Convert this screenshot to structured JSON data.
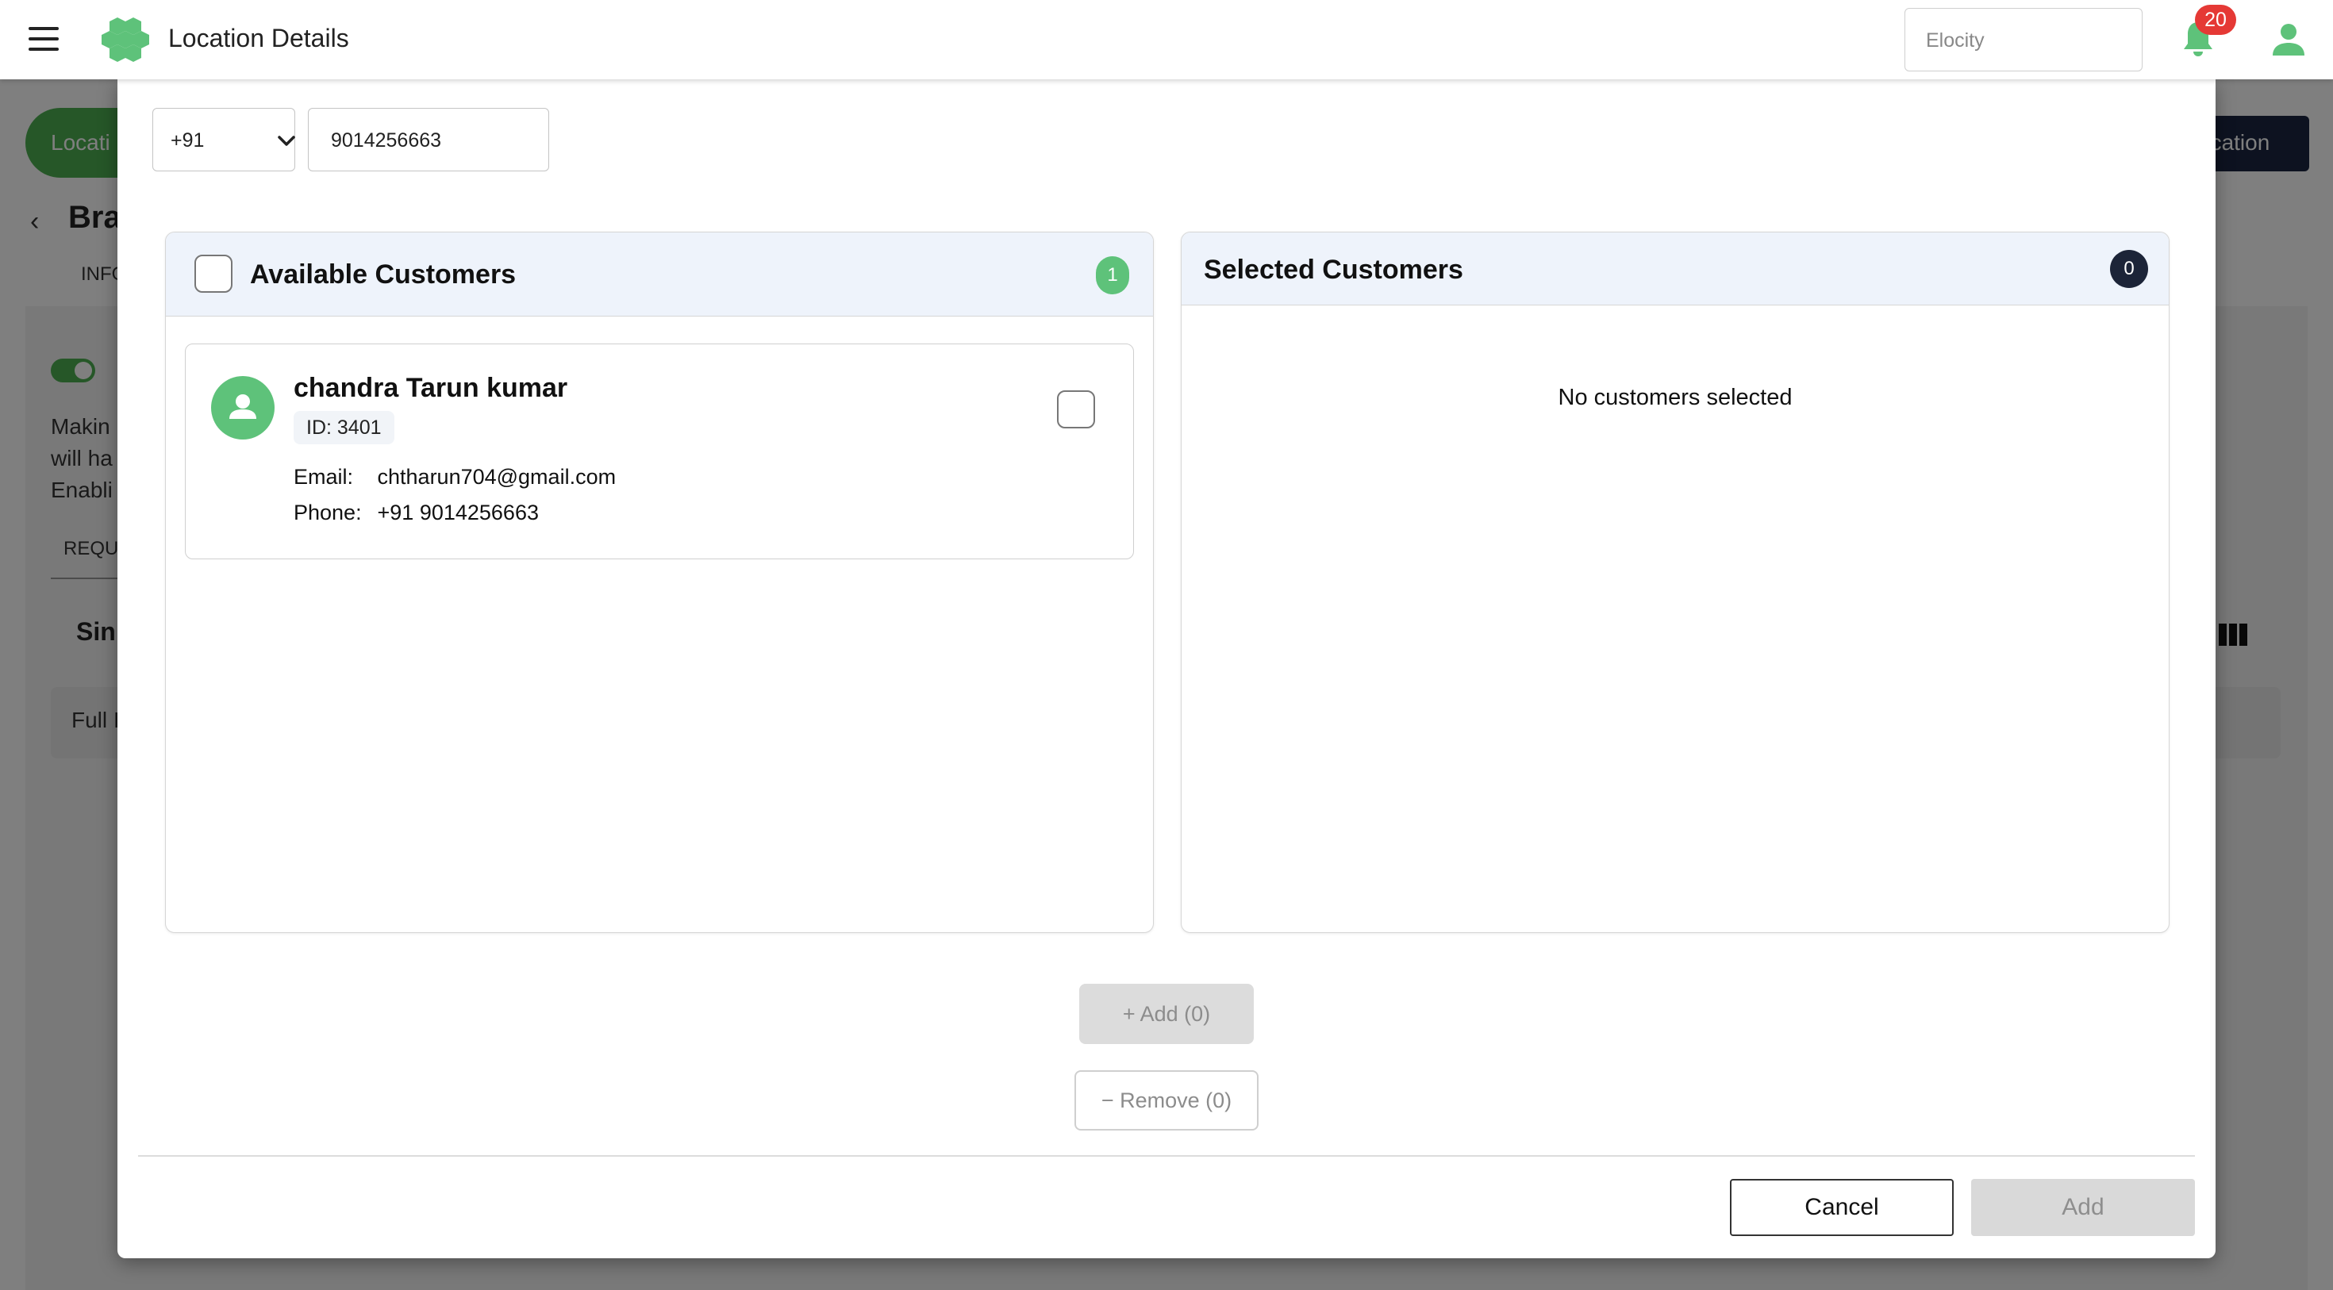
{
  "header": {
    "title": "Location Details",
    "org_select_value": "Elocity",
    "notification_count": "20",
    "icons": [
      "menu-icon",
      "logo",
      "bell-icon",
      "user-icon"
    ],
    "accent_color": "#5ec27a"
  },
  "background": {
    "pill_label": "Locati",
    "location_button": "ocation",
    "back_label": "Bra",
    "tab_info": "INFO",
    "text_lines": [
      "Makin",
      "will ha",
      "Enabli"
    ],
    "req_label": "REQU",
    "section_label": "Sin",
    "row_label": "Full I"
  },
  "modal": {
    "country_code": "+91",
    "phone_value": "9014256663",
    "available": {
      "title": "Available Customers",
      "count": "1",
      "customers": [
        {
          "name": "chandra Tarun kumar",
          "id": "ID: 3401",
          "email_label": "Email:",
          "email": "chtharun704@gmail.com",
          "phone_label": "Phone:",
          "phone": "+91 9014256663"
        }
      ]
    },
    "selected": {
      "title": "Selected Customers",
      "count": "0",
      "empty_message": "No customers selected"
    },
    "add_mid_label": "+ Add (0)",
    "remove_mid_label": "− Remove (0)",
    "cancel_label": "Cancel",
    "add_label": "Add"
  }
}
